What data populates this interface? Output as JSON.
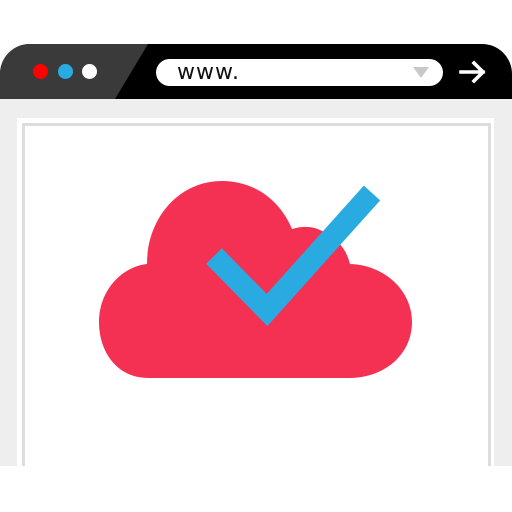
{
  "browser": {
    "url_text": "www.",
    "window_controls": [
      {
        "name": "close",
        "color": "#ff0000"
      },
      {
        "name": "minimize",
        "color": "#29abe2"
      },
      {
        "name": "maximize",
        "color": "#ffffff"
      }
    ],
    "icons": {
      "dropdown": "chevron-down-icon",
      "go": "arrow-right-icon"
    }
  },
  "content": {
    "illustration": "cloud-check-icon",
    "colors": {
      "cloud": "#f43152",
      "check": "#29abe2"
    }
  }
}
